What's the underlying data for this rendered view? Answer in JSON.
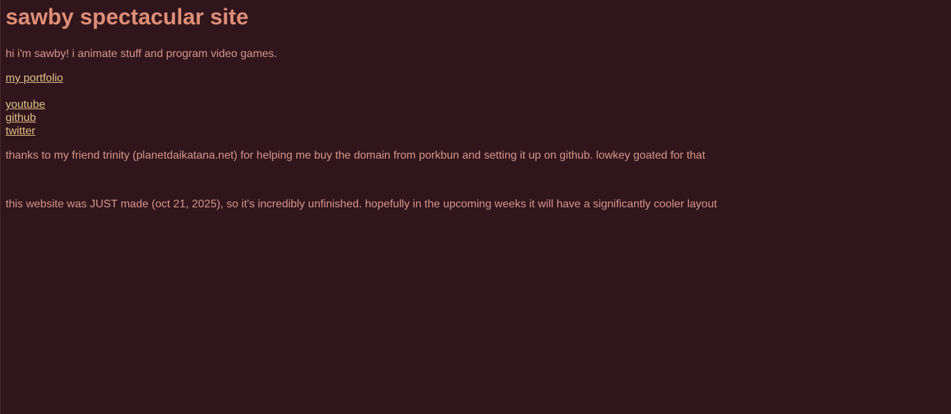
{
  "site": {
    "title": "sawby spectacular site",
    "intro": "hi i'm sawby! i animate stuff and program video games.",
    "portfolio_link": "my portfolio",
    "social_links": [
      "youtube",
      "github",
      "twitter"
    ],
    "thanks": "thanks to my friend trinity (planetdaikatana.net) for helping me buy the domain from porkbun and setting it up on github. lowkey goated for that",
    "notice": "this website was JUST made (oct 21, 2025), so it's incredibly unfinished. hopefully in the upcoming weeks it will have a significantly cooler layout"
  },
  "colors": {
    "background": "#31151c",
    "heading": "#dd8e76",
    "text": "#d6978a",
    "link": "#e2c387"
  }
}
